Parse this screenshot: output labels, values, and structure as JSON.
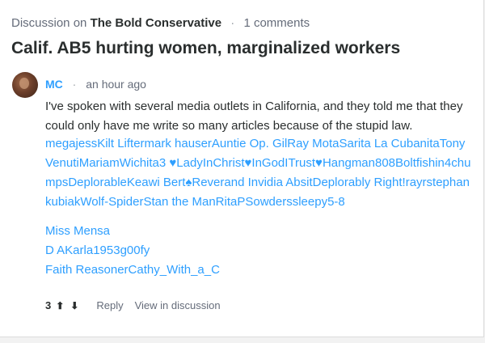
{
  "header": {
    "prefix": "Discussion on",
    "site": "The Bold Conservative",
    "comments": "1 comments"
  },
  "title": "Calif. AB5 hurting women, marginalized workers",
  "comment": {
    "author": "MC",
    "time": "an hour ago",
    "text": "I've spoken with several media outlets in California, and they told me that they could only have me write so many articles because of the stupid law.",
    "links_block": "megajessKilt Liftermark hauserAuntie Op. GilRay MotaSarita La CubanitaTony VenutiMariamWichita3 ♥LadyInChrist♥InGodITrust♥Hangman808Boltfishin4chumpsDeplorableKeawi Bert♠Reverand Invidia AbsitDeplorably Right!rayrstephan kubiakWolf-SpiderStan the ManRitaPSowderssleepy5-8",
    "links_extra": [
      "Miss Mensa",
      "D AKarla1953g00fy",
      "Faith ReasonerCathy_With_a_C"
    ],
    "vote_count": "3",
    "upvote_icon": "arrow-up-icon",
    "downvote_icon": "arrow-down-icon",
    "reply_label": "Reply",
    "view_label": "View in discussion"
  },
  "colors": {
    "link": "#2e9fff",
    "text": "#2a2e2e",
    "muted": "#656c7a"
  }
}
